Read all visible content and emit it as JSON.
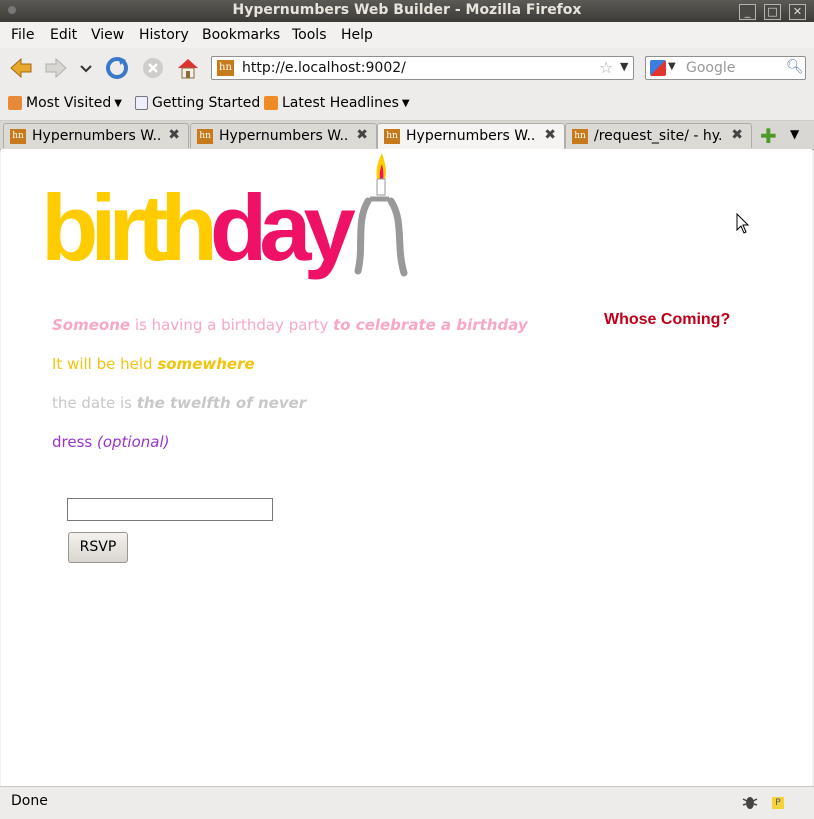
{
  "window": {
    "title": "Hypernumbers Web Builder - Mozilla Firefox"
  },
  "menu": [
    "File",
    "Edit",
    "View",
    "History",
    "Bookmarks",
    "Tools",
    "Help"
  ],
  "urlbar": {
    "value": "http://e.localhost:9002/",
    "favicon": "hn"
  },
  "search": {
    "placeholder": "Google"
  },
  "bookmarks": [
    "Most Visited",
    "Getting Started",
    "Latest Headlines"
  ],
  "tabs": [
    {
      "label": "Hypernumbers W..."
    },
    {
      "label": "Hypernumbers W..."
    },
    {
      "label": "Hypernumbers W..."
    },
    {
      "label": "/request_site/ - hy..."
    }
  ],
  "page": {
    "logo_birth": "birth",
    "logo_day": "day",
    "line1": {
      "a": "Someone",
      "b": " is having a birthday party ",
      "c": "to celebrate a birthday"
    },
    "line2": {
      "a": "It will be held ",
      "b": "somewhere"
    },
    "line3": {
      "a": "the date is ",
      "b": "the twelfth of never"
    },
    "line4": {
      "a": "dress ",
      "b": "(optional)"
    },
    "whose_coming": "Whose Coming?",
    "rsvp_value": "",
    "rsvp_button": "RSVP"
  },
  "status": {
    "text": "Done"
  },
  "colors": {
    "yellow": "#ffcc00",
    "pink": "#ee1166",
    "red": "#c00018",
    "purple": "#9933cc"
  }
}
